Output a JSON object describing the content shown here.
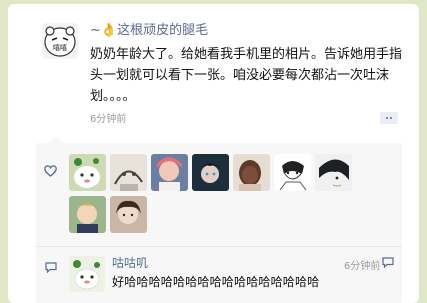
{
  "post": {
    "avatar_text": "嘻嘻",
    "author": "~👌这根顽皮的腿毛",
    "content": "奶奶年龄大了。给她看我手机里的相片。告诉她用手指头一划就可以看下一张。咱没必要每次都沾一次吐沫划。。。。",
    "time": "6分钟前"
  },
  "likers": [
    {
      "name": "liker-1",
      "bg": "#cfd9b3"
    },
    {
      "name": "liker-2",
      "bg": "#e7e2da"
    },
    {
      "name": "liker-3",
      "bg": "#6b7fa3"
    },
    {
      "name": "liker-4",
      "bg": "#1d2f3b"
    },
    {
      "name": "liker-5",
      "bg": "#e8ddd2"
    },
    {
      "name": "liker-6",
      "bg": "#ffffff"
    },
    {
      "name": "liker-7",
      "bg": "#eef0f2"
    },
    {
      "name": "liker-8",
      "bg": "#9cb58a"
    },
    {
      "name": "liker-9",
      "bg": "#c9b6a6"
    }
  ],
  "comment": {
    "author": "咕咕叽",
    "time": "6分钟前",
    "text": "好哈哈哈哈哈哈哈哈哈哈哈哈哈哈哈哈"
  },
  "colors": {
    "link": "#576b95",
    "panel": "#f7f7f7",
    "frame": "#dfe7c6"
  },
  "icons": [
    "heart-icon",
    "comment-bubble-icon",
    "reply-icon",
    "more-options-icon",
    "ok-hand-icon"
  ]
}
